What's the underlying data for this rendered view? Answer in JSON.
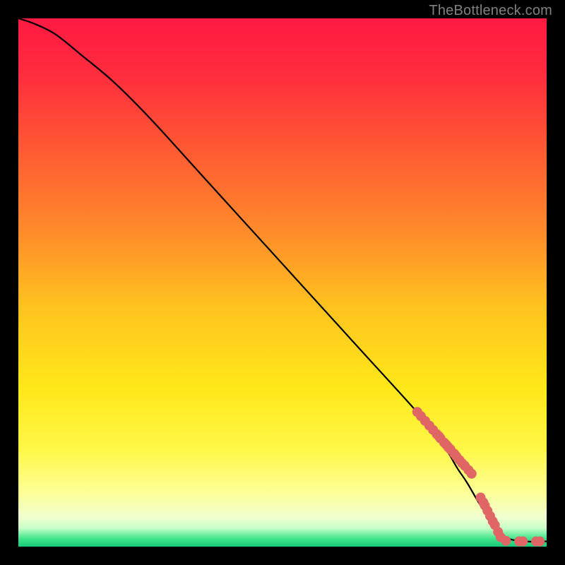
{
  "attribution": "TheBottleneck.com",
  "chart_data": {
    "type": "line",
    "title": "",
    "xlabel": "",
    "ylabel": "",
    "xlim": [
      0,
      100
    ],
    "ylim": [
      0,
      100
    ],
    "gradient_stops": [
      {
        "offset": 0.0,
        "color": "#ff1a42"
      },
      {
        "offset": 0.1,
        "color": "#ff2b3e"
      },
      {
        "offset": 0.25,
        "color": "#ff5a33"
      },
      {
        "offset": 0.4,
        "color": "#ff8a2b"
      },
      {
        "offset": 0.55,
        "color": "#ffc41f"
      },
      {
        "offset": 0.7,
        "color": "#ffe81a"
      },
      {
        "offset": 0.82,
        "color": "#fff84a"
      },
      {
        "offset": 0.9,
        "color": "#fdff9a"
      },
      {
        "offset": 0.945,
        "color": "#f0ffd0"
      },
      {
        "offset": 0.965,
        "color": "#c8ffc8"
      },
      {
        "offset": 0.985,
        "color": "#3fe58a"
      },
      {
        "offset": 1.0,
        "color": "#17c97a"
      }
    ],
    "curve": {
      "x": [
        0,
        3,
        7,
        12,
        18,
        25,
        35,
        45,
        55,
        65,
        75,
        80,
        83,
        85,
        88,
        92,
        96,
        100
      ],
      "y": [
        100,
        99,
        97,
        93,
        88,
        81,
        70,
        59,
        48,
        37,
        26,
        20,
        15,
        12,
        7,
        2,
        1,
        1
      ]
    },
    "markers": {
      "x": [
        75.5,
        76.2,
        77.0,
        77.8,
        78.5,
        79.2,
        79.6,
        79.9,
        80.6,
        81.0,
        81.4,
        81.8,
        82.5,
        82.9,
        83.5,
        84.0,
        84.5,
        85.2,
        85.8,
        87.5,
        88.0,
        88.3,
        88.8,
        89.3,
        89.8,
        90.2,
        90.8,
        91.3,
        92.3,
        94.8,
        95.5,
        98.0,
        98.7
      ],
      "y": [
        25.5,
        24.7,
        23.8,
        22.9,
        22.1,
        21.3,
        20.9,
        20.5,
        19.7,
        19.3,
        18.8,
        18.4,
        17.6,
        17.1,
        16.4,
        15.8,
        15.3,
        14.5,
        13.8,
        9.3,
        8.4,
        7.8,
        6.8,
        5.8,
        4.8,
        4.1,
        2.8,
        1.8,
        1.1,
        1.0,
        1.0,
        1.0,
        1.0
      ],
      "color": "#e06666",
      "radius": 7
    }
  }
}
